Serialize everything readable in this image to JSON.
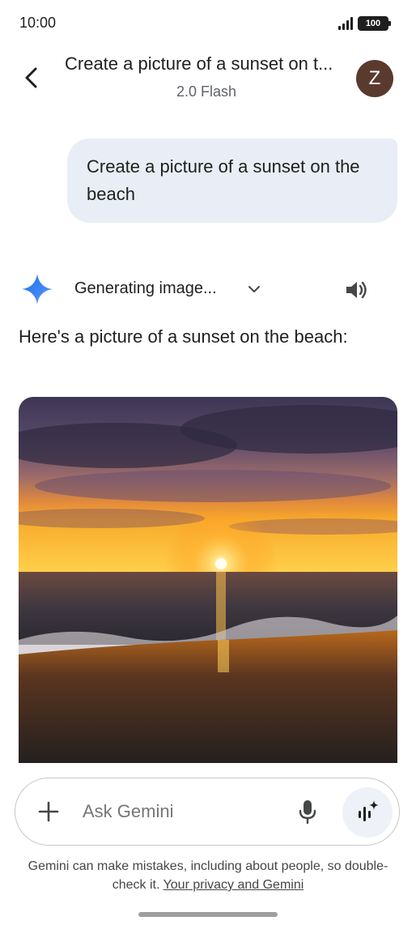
{
  "status_bar": {
    "time": "10:00",
    "battery": "100"
  },
  "header": {
    "title": "Create a picture of a sunset on t...",
    "model": "2.0 Flash",
    "avatar_letter": "Z"
  },
  "conversation": {
    "user_message": "Create a picture of a sunset on the beach",
    "status_label": "Generating image...",
    "response_text": "Here's a picture of a sunset on the beach:"
  },
  "input": {
    "placeholder": "Ask Gemini"
  },
  "footer": {
    "disclaimer": "Gemini can make mistakes, including about people, so double-check it.",
    "privacy_link": "Your privacy and Gemini"
  },
  "icons": {
    "back": "arrow-back-icon",
    "spark": "gemini-spark-icon",
    "chevron": "chevron-down-icon",
    "speaker": "speaker-icon",
    "plus": "plus-icon",
    "mic": "mic-icon",
    "live": "gemini-live-icon"
  },
  "colors": {
    "bubble": "#e9eef6",
    "avatar": "#5b3a2e",
    "spark_blue": "#4285f4",
    "live_button": "#eef1f8"
  }
}
